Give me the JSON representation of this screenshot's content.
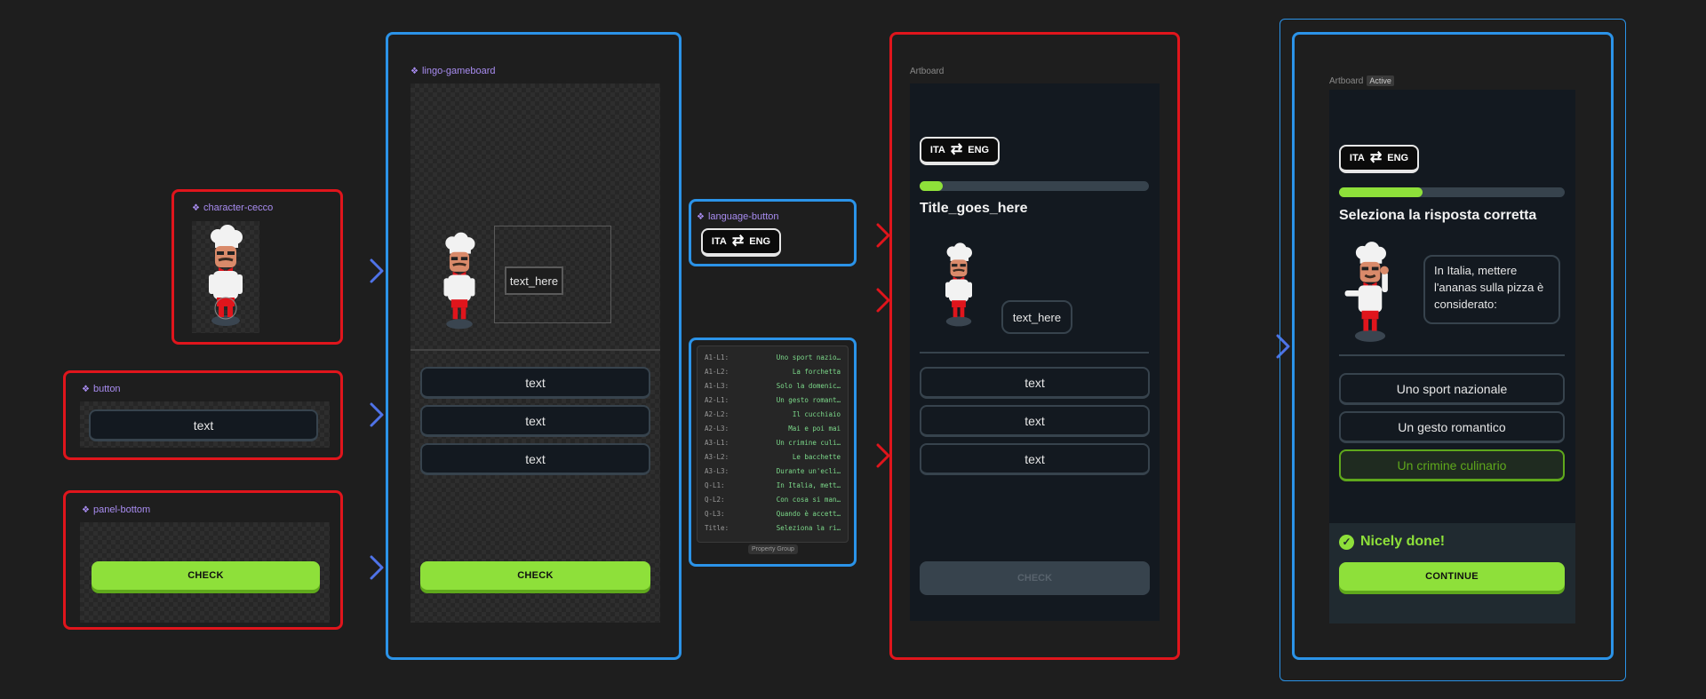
{
  "components": {
    "character": {
      "label": "character-cecco"
    },
    "button": {
      "label": "button",
      "text": "text"
    },
    "panel_bottom": {
      "label": "panel-bottom",
      "check": "CHECK"
    },
    "gameboard": {
      "label": "lingo-gameboard",
      "bubble": "text_here",
      "options": [
        "text",
        "text",
        "text"
      ],
      "check": "CHECK"
    },
    "language_button": {
      "label": "language-button",
      "left": "ITA",
      "right": "ENG"
    },
    "property_group": {
      "tag": "Property Group",
      "rows": [
        {
          "key": "A1-L1:",
          "value": "Uno sport nazio…"
        },
        {
          "key": "A1-L2:",
          "value": "La forchetta"
        },
        {
          "key": "A1-L3:",
          "value": "Solo la domenic…"
        },
        {
          "key": "A2-L1:",
          "value": "Un gesto romant…"
        },
        {
          "key": "A2-L2:",
          "value": "Il cucchiaio"
        },
        {
          "key": "A2-L3:",
          "value": "Mai e poi mai"
        },
        {
          "key": "A3-L1:",
          "value": "Un crimine culi…"
        },
        {
          "key": "A3-L2:",
          "value": "Le bacchette"
        },
        {
          "key": "A3-L3:",
          "value": "Durante un'ecli…"
        },
        {
          "key": "Q-L1:",
          "value": "In Italia, mett…"
        },
        {
          "key": "Q-L2:",
          "value": "Con cosa si man…"
        },
        {
          "key": "Q-L3:",
          "value": "Quando è accett…"
        },
        {
          "key": "Title:",
          "value": "Seleziona la ri…"
        }
      ]
    }
  },
  "artboard": {
    "label": "Artboard",
    "lang_left": "ITA",
    "lang_right": "ENG",
    "progress": 0.1,
    "title": "Title_goes_here",
    "bubble": "text_here",
    "options": [
      "text",
      "text",
      "text"
    ],
    "check": "CHECK"
  },
  "active_artboard": {
    "label": "Artboard",
    "badge": "Active",
    "lang_left": "ITA",
    "lang_right": "ENG",
    "progress": 0.37,
    "title": "Seleziona la risposta corretta",
    "bubble": "In Italia, mettere l'ananas sulla pizza è considerato:",
    "options": [
      "Uno sport nazionale",
      "Un gesto romantico",
      "Un crimine culinario"
    ],
    "feedback": "Nicely done!",
    "continue": "CONTINUE"
  },
  "colors": {
    "red_frame": "#e0151c",
    "blue_frame": "#2b93e8",
    "accent_green": "#8ee03a",
    "panel_bg": "#131920"
  },
  "icons": [
    "component-diamond-icon",
    "swap-arrows-icon",
    "check-circle-icon",
    "chef-character"
  ]
}
